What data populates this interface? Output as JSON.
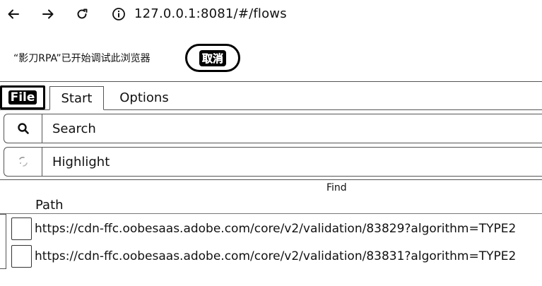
{
  "browser": {
    "url": "127.0.0.1:8081/#/flows",
    "icons": [
      "arrow-left-icon",
      "arrow-right-icon",
      "reload-icon",
      "info-icon"
    ]
  },
  "notice": {
    "message": "“影刀RPA”已开始调试此浏览器",
    "cancel_label": "取消"
  },
  "tabs": [
    {
      "label": "File",
      "active": false,
      "focused": true
    },
    {
      "label": "Start",
      "active": true
    },
    {
      "label": "Options",
      "active": false
    }
  ],
  "find": {
    "search_placeholder": "Search",
    "highlight_placeholder": "Highlight",
    "section_label": "Find"
  },
  "table": {
    "columns": [
      "Path"
    ],
    "rows": [
      {
        "path": "https://cdn-ffc.oobesaas.adobe.com/core/v2/validation/83829?algorithm=TYPE2"
      },
      {
        "path": "https://cdn-ffc.oobesaas.adobe.com/core/v2/validation/83831?algorithm=TYPE2"
      }
    ]
  },
  "colors": {
    "border": "#555555",
    "text": "#111111",
    "background": "#ffffff"
  }
}
